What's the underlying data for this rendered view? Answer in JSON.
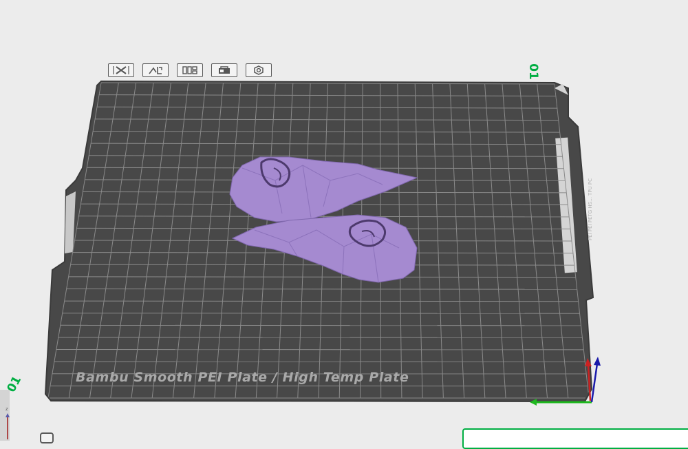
{
  "viewport": {
    "plate_number": "01",
    "corner_plate_number": "01",
    "plate_label": "Bambu Smooth PEI Plate / High Temp Plate",
    "side_tag": "PEI PEI PETG HS... TPU PC",
    "toolbar": [
      {
        "name": "close-plate-icon",
        "tooltip": ""
      },
      {
        "name": "auto-orient-icon",
        "tooltip": ""
      },
      {
        "name": "arrange-icon",
        "tooltip": ""
      },
      {
        "name": "lock-plate-icon",
        "tooltip": ""
      },
      {
        "name": "plate-settings-icon",
        "tooltip": ""
      }
    ],
    "colors": {
      "background": "#ececec",
      "plate": "#484848",
      "grid": "#8a8a8a",
      "model": "#a58ad0",
      "accent_green": "#00ae42",
      "axis_x": "#1fb81f",
      "axis_y": "#cc2222",
      "axis_z": "#1a1aaa"
    }
  }
}
